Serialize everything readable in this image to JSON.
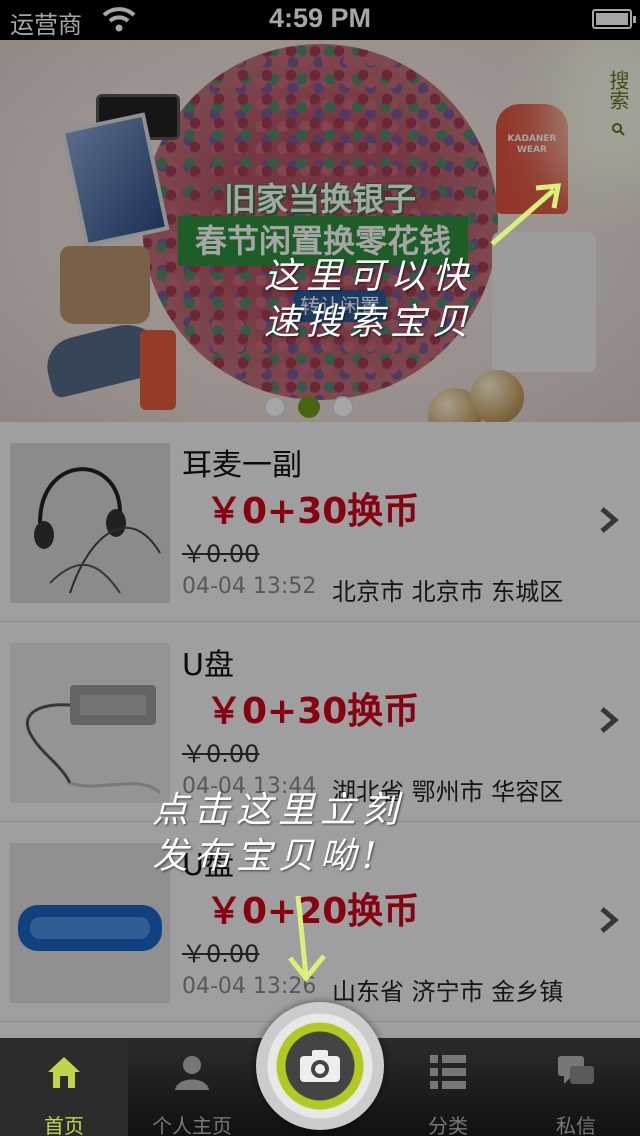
{
  "status_bar": {
    "carrier": "运营商",
    "time": "4:59 PM"
  },
  "banner": {
    "promo_line1": "旧家当换银子",
    "promo_line2": "春节闲置换零花钱",
    "promo_button": "转让闲置",
    "hoodie_text": "KADANER WEAR",
    "slides_total": 3,
    "active_slide": 2,
    "search_label": "搜索"
  },
  "items": [
    {
      "title": "耳麦一副",
      "price": "￥0+30换币",
      "original_price": "￥0.00",
      "time": "04-04 13:52",
      "location": "北京市 北京市 东城区"
    },
    {
      "title": "U盘",
      "price": "￥0+30换币",
      "original_price": "￥0.00",
      "time": "04-04 13:44",
      "location": "湖北省 鄂州市 华容区"
    },
    {
      "title": "U盘",
      "price": "￥0+20换币",
      "original_price": "￥0.00",
      "time": "04-04 13:26",
      "location": "山东省 济宁市 金乡镇"
    }
  ],
  "annotations": {
    "search_hint_line1": "这里可以快",
    "search_hint_line2": "速搜索宝贝",
    "publish_hint_line1": "点击这里立刻",
    "publish_hint_line2": "发布宝贝呦!"
  },
  "tabbar": {
    "home": "首页",
    "profile": "个人主页",
    "category": "分类",
    "messages": "私信"
  },
  "colors": {
    "accent_green": "#b3c822",
    "price_red": "#d0021b",
    "banner_green": "#2f8f3c"
  },
  "icons": [
    "wifi-icon",
    "battery-icon",
    "search-icon",
    "chevron-right-icon",
    "home-icon",
    "person-icon",
    "camera-icon",
    "list-icon",
    "chat-icon"
  ]
}
